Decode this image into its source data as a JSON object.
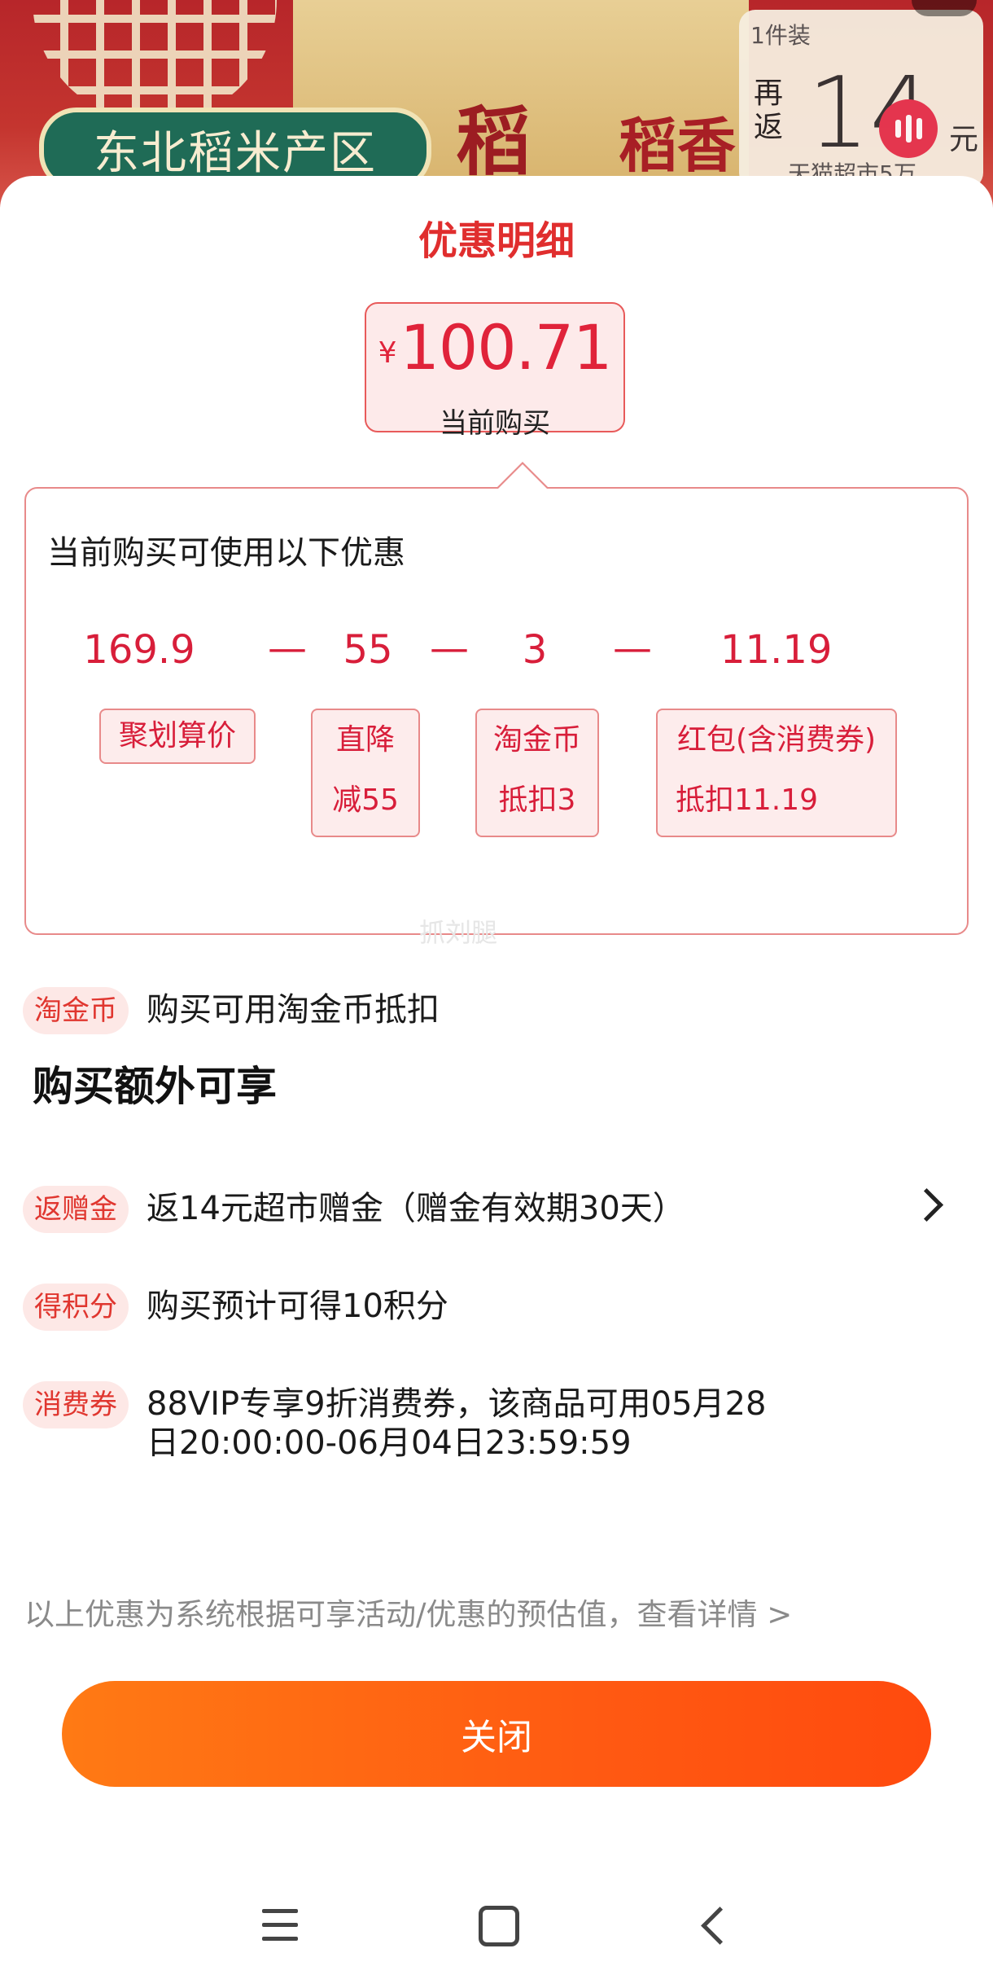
{
  "banner": {
    "region_text": "东北稻米产区",
    "brand_text_1": "稻",
    "brand_text_2": "稻香",
    "promo": {
      "pack": "1件装",
      "again": "再返",
      "amount": "14",
      "unit": "元",
      "store": "天猫超市5万"
    }
  },
  "sheet": {
    "title": "优惠明细",
    "price": {
      "currency": "¥",
      "amount": "100.71",
      "label": "当前购买"
    },
    "calc": {
      "heading": "当前购买可使用以下优惠",
      "items": [
        {
          "value": "169.9",
          "tag": [
            "聚划算价"
          ]
        },
        {
          "value": "55",
          "tag": [
            "直降",
            "减55"
          ]
        },
        {
          "value": "3",
          "tag": [
            "淘金币",
            "抵扣3"
          ]
        },
        {
          "value": "11.19",
          "tag": [
            "红包(含消费券)",
            "抵扣11.19"
          ]
        }
      ],
      "operator": "—"
    },
    "watermark": "抓刘腿",
    "coin_row": {
      "pill": "淘金币",
      "text": "购买可用淘金币抵扣"
    },
    "extra_heading": "购买额外可享",
    "extras": [
      {
        "pill": "返赠金",
        "text": "返14元超市赠金（赠金有效期30天）"
      },
      {
        "pill": "得积分",
        "text": "购买预计可得10积分"
      },
      {
        "pill": "消费券",
        "text_line1": "88VIP专享9折消费券，该商品可用05月28",
        "text_line2": "日20:00:00-06月04日23:59:59"
      }
    ],
    "disclaimer": "以上优惠为系统根据可享活动/优惠的预估值，查看详情 >",
    "close_label": "关闭"
  },
  "colors": {
    "accent_red": "#e0233a",
    "button_orange": "#ff6a14",
    "pill_bg": "#fde8e6"
  }
}
